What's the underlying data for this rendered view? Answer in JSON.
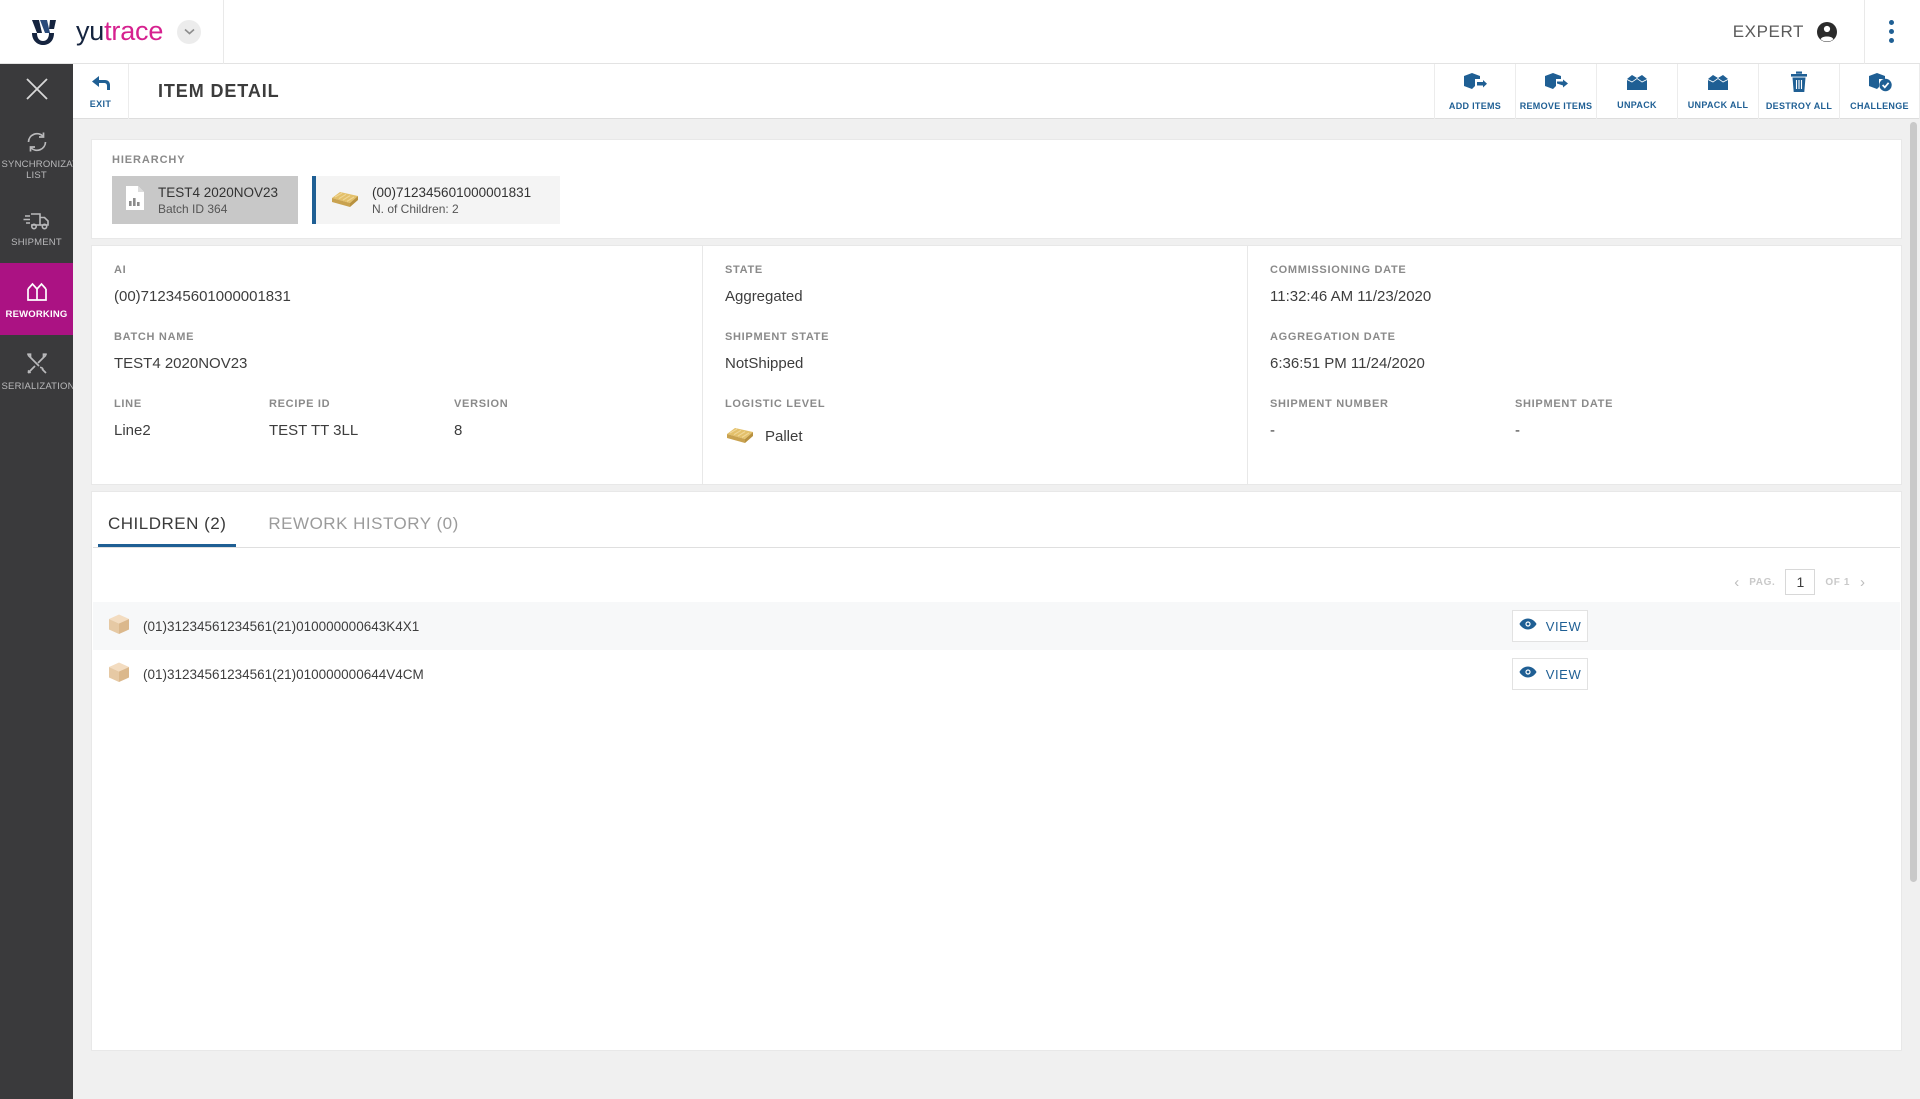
{
  "header": {
    "brand_yu": "yu",
    "brand_trace": "trace",
    "logo_icon": "yutrace-logo-icon",
    "brand_caret_icon": "chevron-down-icon",
    "expert_label": "EXPERT",
    "account_icon": "account-circle-icon",
    "kebab_icon": "more-vertical-icon"
  },
  "sidebar": {
    "close_icon": "close-icon",
    "items": [
      {
        "label": "SYNCHRONIZATION LIST",
        "icon": "sync-icon",
        "active": false
      },
      {
        "label": "SHIPMENT",
        "icon": "truck-icon",
        "active": false
      },
      {
        "label": "REWORKING",
        "icon": "open-box-icon",
        "active": true
      },
      {
        "label": "SERIALIZATION",
        "icon": "tools-icon",
        "active": false
      }
    ],
    "active_color": "#ab1283"
  },
  "pagehead": {
    "exit_label": "EXIT",
    "exit_icon": "exit-arrow-icon",
    "title": "ITEM DETAIL",
    "tools": [
      {
        "label": "ADD ITEMS",
        "icon": "box-add-icon"
      },
      {
        "label": "REMOVE ITEMS",
        "icon": "box-remove-icon"
      },
      {
        "label": "UNPACK",
        "icon": "unpack-icon"
      },
      {
        "label": "UNPACK ALL",
        "icon": "unpack-all-icon"
      },
      {
        "label": "DESTROY ALL",
        "icon": "trash-icon"
      },
      {
        "label": "CHALLENGE",
        "icon": "box-check-icon"
      }
    ],
    "accent_color": "#1f5f94"
  },
  "hierarchy": {
    "section_label": "HIERARCHY",
    "nodes": [
      {
        "title": "TEST4 2020NOV23",
        "subtitle": "Batch ID 364",
        "icon": "batch-chart-icon",
        "state": "parent"
      },
      {
        "title": "(00)712345601000001831",
        "subtitle": "N. of Children: 2",
        "icon": "pallet-icon",
        "state": "current"
      }
    ]
  },
  "detail": {
    "ai": {
      "label": "AI",
      "value": "(00)712345601000001831"
    },
    "batch_name": {
      "label": "BATCH NAME",
      "value": "TEST4 2020NOV23"
    },
    "line": {
      "label": "LINE",
      "value": "Line2"
    },
    "recipe_id": {
      "label": "RECIPE ID",
      "value": "TEST TT 3LL"
    },
    "version": {
      "label": "VERSION",
      "value": "8"
    },
    "state": {
      "label": "STATE",
      "value": "Aggregated"
    },
    "shipment_state": {
      "label": "SHIPMENT STATE",
      "value": "NotShipped"
    },
    "logistic_level": {
      "label": "LOGISTIC LEVEL",
      "value": "Pallet",
      "icon": "pallet-icon"
    },
    "commissioning_date": {
      "label": "COMMISSIONING DATE",
      "value": "11:32:46 AM 11/23/2020"
    },
    "aggregation_date": {
      "label": "AGGREGATION DATE",
      "value": "6:36:51 PM 11/24/2020"
    },
    "shipment_number": {
      "label": "SHIPMENT NUMBER",
      "value": "-"
    },
    "shipment_date": {
      "label": "SHIPMENT DATE",
      "value": "-"
    }
  },
  "tabs": [
    {
      "label": "CHILDREN (2)",
      "active": true
    },
    {
      "label": "REWORK HISTORY (0)",
      "active": false
    }
  ],
  "pagination": {
    "prev_icon": "chevron-left-icon",
    "next_icon": "chevron-right-icon",
    "page_word": "PAG.",
    "current_page": "1",
    "of_word": "OF 1"
  },
  "children": {
    "view_label": "VIEW",
    "view_icon": "eye-icon",
    "row_icon": "box-icon",
    "rows": [
      {
        "code": "(01)31234561234561(21)010000000643K4X1"
      },
      {
        "code": "(01)31234561234561(21)010000000644V4CM"
      }
    ]
  },
  "scrollbar": {
    "thumb": "vertical-scroll-thumb"
  }
}
